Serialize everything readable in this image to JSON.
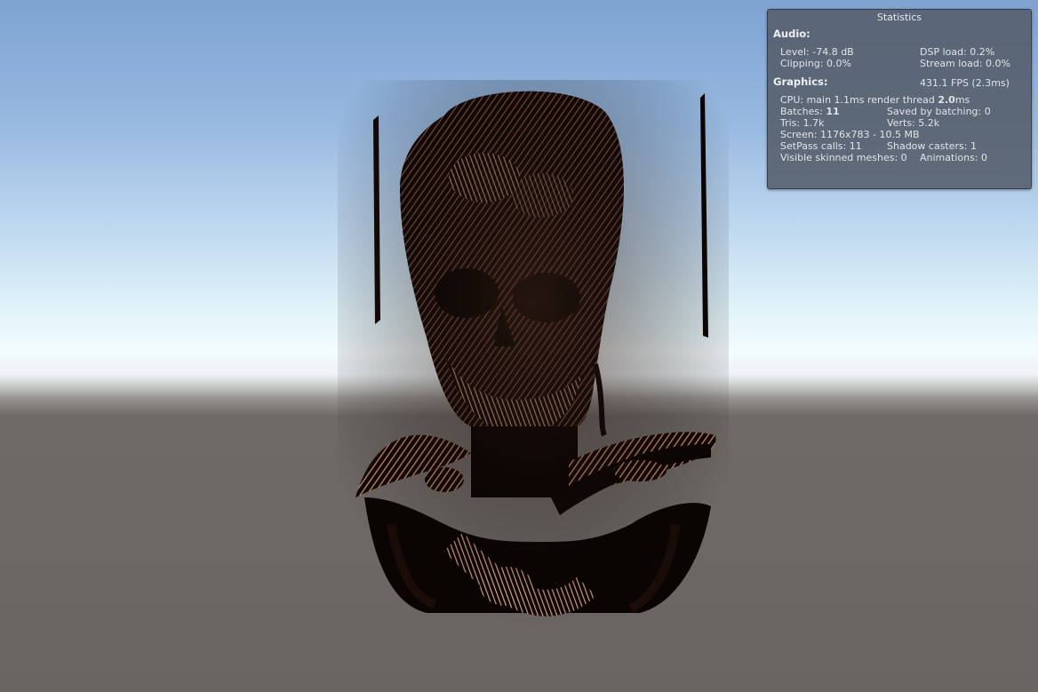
{
  "stats": {
    "title": "Statistics",
    "audio": {
      "heading": "Audio:",
      "level": "Level: -74.8 dB",
      "dsp_load": "DSP load: 0.2%",
      "clipping": "Clipping: 0.0%",
      "stream_load": "Stream load: 0.0%"
    },
    "graphics": {
      "heading": "Graphics:",
      "fps": "431.1 FPS (2.3ms)",
      "cpu_prefix": "CPU: main 1.1ms  render thread ",
      "cpu_render_value": "2.0",
      "cpu_suffix": "ms",
      "batches_prefix": "Batches: ",
      "batches_value": "11",
      "saved_by_batching": "Saved by batching: 0",
      "tris": "Tris: 1.7k",
      "verts": "Verts: 5.2k",
      "screen": "Screen: 1176x783 - 10.5 MB",
      "setpass": "SetPass calls: 11",
      "shadow_casters": "Shadow casters: 1",
      "visible_skinned": "Visible skinned meshes: 0",
      "animations": "Animations: 0"
    }
  },
  "scene": {
    "sky_color_top": "#7ea3d1",
    "sky_color_horizon": "#f2fbfd",
    "ground_color": "#6b6561",
    "render_dark": "#0c0604",
    "render_highlight": "#e6a48e"
  }
}
